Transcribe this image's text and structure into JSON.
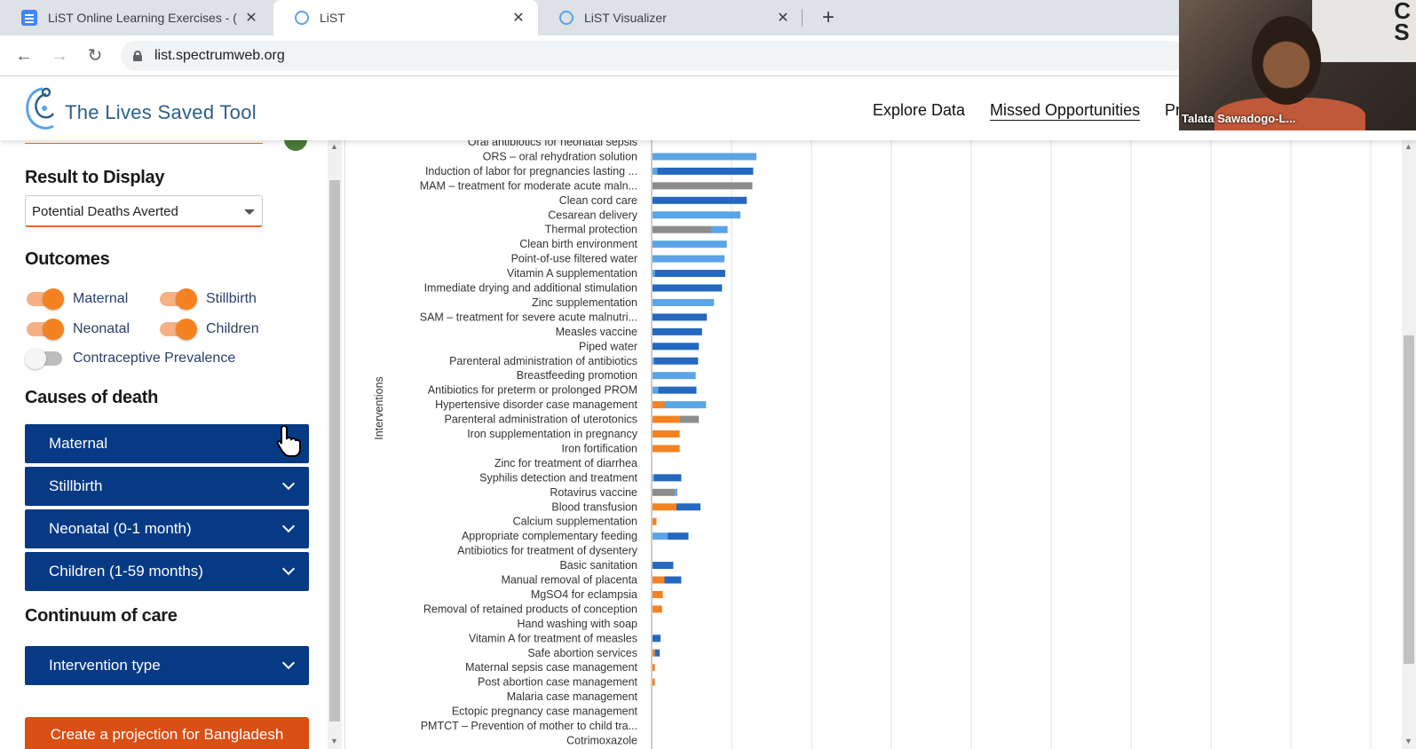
{
  "browser": {
    "tabs": [
      {
        "title": "LiST Online Learning Exercises - (",
        "icon": "docs-icon",
        "active": false
      },
      {
        "title": "LiST",
        "icon": "list-logo-icon",
        "active": true
      },
      {
        "title": "LiST Visualizer",
        "icon": "list-logo-icon",
        "active": false
      }
    ],
    "new_tab": "+",
    "url": "list.spectrumweb.org",
    "close_glyph": "✕"
  },
  "header": {
    "logo_text": "The Lives Saved Tool",
    "nav": [
      "Explore Data",
      "Missed Opportunities",
      "Pr"
    ]
  },
  "webcam": {
    "participant_name": "Talata Sawadogo-L..."
  },
  "sidebar": {
    "result_heading": "Result to Display",
    "result_value": "Potential Deaths Averted",
    "outcomes_heading": "Outcomes",
    "outcomes": [
      {
        "label": "Maternal",
        "on": true
      },
      {
        "label": "Stillbirth",
        "on": true
      },
      {
        "label": "Neonatal",
        "on": true
      },
      {
        "label": "Children",
        "on": true
      },
      {
        "label": "Contraceptive Prevalence",
        "on": false
      }
    ],
    "causes_heading": "Causes of death",
    "causes": [
      "Maternal",
      "Stillbirth",
      "Neonatal (0-1 month)",
      "Children (1-59 months)"
    ],
    "continuum_heading": "Continuum of care",
    "continuum": [
      "Intervention type"
    ],
    "cta_label": "Create a projection for Bangladesh"
  },
  "colors": {
    "maternal": "#f58220",
    "stillbirth": "#8c8c8c",
    "neonatal": "#5ba4e6",
    "children": "#2468c0",
    "accordion": "#073a85",
    "cta": "#d94f14"
  },
  "chart_data": {
    "type": "bar",
    "orientation": "horizontal",
    "stacked": true,
    "ylabel": "Interventions",
    "grid": true,
    "categories": [
      "Oral antibiotics for neonatal sepsis",
      "ORS – oral rehydration solution",
      "Induction of labor for pregnancies lasting ...",
      "MAM – treatment for moderate acute maln...",
      "Clean cord care",
      "Cesarean delivery",
      "Thermal protection",
      "Clean birth environment",
      "Point-of-use filtered water",
      "Vitamin A supplementation",
      "Immediate drying and additional stimulation",
      "Zinc supplementation",
      "SAM – treatment for severe acute malnutri...",
      "Measles vaccine",
      "Piped water",
      "Parenteral administration of antibiotics",
      "Breastfeeding promotion",
      "Antibiotics for preterm or prolonged PROM",
      "Hypertensive disorder case management",
      "Parenteral administration of uterotonics",
      "Iron supplementation in pregnancy",
      "Iron fortification",
      "Zinc for treatment of diarrhea",
      "Syphilis detection and treatment",
      "Rotavirus vaccine",
      "Blood transfusion",
      "Calcium supplementation",
      "Appropriate complementary feeding",
      "Antibiotics for treatment of dysentery",
      "Basic sanitation",
      "Manual removal of placenta",
      "MgSO4 for eclampsia",
      "Removal of retained products of conception",
      "Hand washing with soap",
      "Vitamin A for treatment of measles",
      "Safe abortion services",
      "Maternal sepsis case management",
      "Post abortion case management",
      "Malaria case management",
      "Ectopic pregnancy case management",
      "PMTCT – Prevention of mother to child tra...",
      "Cotrimoxazole"
    ],
    "series": [
      {
        "name": "Maternal",
        "color": "#f58220",
        "values": [
          0,
          0,
          0,
          0,
          0,
          0,
          0,
          0,
          0,
          0,
          0,
          0,
          0,
          0,
          0,
          0,
          0,
          0,
          0.15,
          0.34,
          0.34,
          0.34,
          0,
          0,
          0,
          0.3,
          0.05,
          0,
          0,
          0,
          0.15,
          0.13,
          0.12,
          0,
          0,
          0.03,
          0.03,
          0.03,
          0,
          0,
          0,
          0
        ]
      },
      {
        "name": "Stillbirth",
        "color": "#8c8c8c",
        "values": [
          0,
          0,
          0,
          1.25,
          0,
          0,
          0.74,
          0,
          0,
          0,
          0,
          0,
          0,
          0,
          0,
          0,
          0,
          0,
          0,
          0.24,
          0,
          0,
          0,
          0,
          0.28,
          0,
          0,
          0,
          0,
          0,
          0,
          0,
          0,
          0,
          0,
          0,
          0,
          0,
          0,
          0,
          0,
          0
        ]
      },
      {
        "name": "Neonatal",
        "color": "#5ba4e6",
        "values": [
          0,
          1.3,
          0.06,
          0,
          0,
          1.1,
          0.2,
          0.93,
          0.9,
          0.03,
          0,
          0.77,
          0,
          0,
          0,
          0.02,
          0.54,
          0.07,
          0.52,
          0,
          0,
          0,
          0,
          0.02,
          0.03,
          0,
          0,
          0.19,
          0,
          0,
          0,
          0,
          0,
          0,
          0,
          0,
          0,
          0,
          0,
          0,
          0,
          0
        ]
      },
      {
        "name": "Children",
        "color": "#2468c0",
        "values": [
          0,
          0,
          1.2,
          0,
          1.18,
          0,
          0,
          0,
          0,
          0.88,
          0.87,
          0,
          0.68,
          0.62,
          0.58,
          0.55,
          0,
          0.48,
          0,
          0,
          0,
          0,
          0,
          0.34,
          0,
          0.3,
          0,
          0.26,
          0,
          0.26,
          0.21,
          0,
          0,
          0,
          0.1,
          0.06,
          0,
          0,
          0,
          0,
          0,
          0
        ]
      }
    ]
  }
}
